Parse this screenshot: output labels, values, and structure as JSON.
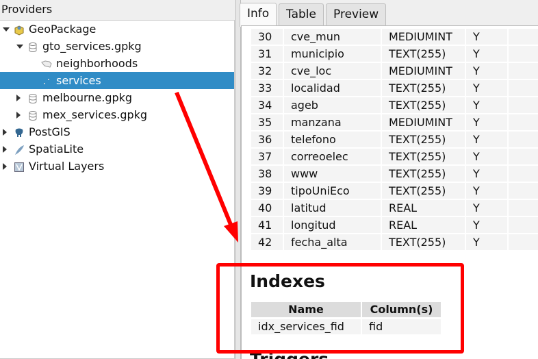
{
  "providers_title": "Providers",
  "tree": [
    {
      "label": "GeoPackage",
      "icon": "geopackage-icon",
      "level": 0,
      "expanded": true
    },
    {
      "label": "gto_services.gpkg",
      "icon": "database-icon",
      "level": 1,
      "expanded": true
    },
    {
      "label": "neighborhoods",
      "icon": "polygon-layer-icon",
      "level": 2
    },
    {
      "label": "services",
      "icon": "point-layer-icon",
      "level": 2,
      "selected": true
    },
    {
      "label": "melbourne.gpkg",
      "icon": "database-icon",
      "level": 1,
      "expanded": false
    },
    {
      "label": "mex_services.gpkg",
      "icon": "database-icon",
      "level": 1,
      "expanded": false
    },
    {
      "label": "PostGIS",
      "icon": "postgis-icon",
      "level": 0,
      "expanded": false
    },
    {
      "label": "SpatiaLite",
      "icon": "spatialite-feather-icon",
      "level": 0,
      "expanded": false
    },
    {
      "label": "Virtual Layers",
      "icon": "virtual-layers-icon",
      "level": 0,
      "expanded": false
    }
  ],
  "tabs": [
    "Info",
    "Table",
    "Preview"
  ],
  "fields": [
    [
      "30",
      "cve_mun",
      "MEDIUMINT",
      "Y"
    ],
    [
      "31",
      "municipio",
      "TEXT(255)",
      "Y"
    ],
    [
      "32",
      "cve_loc",
      "MEDIUMINT",
      "Y"
    ],
    [
      "33",
      "localidad",
      "TEXT(255)",
      "Y"
    ],
    [
      "34",
      "ageb",
      "TEXT(255)",
      "Y"
    ],
    [
      "35",
      "manzana",
      "MEDIUMINT",
      "Y"
    ],
    [
      "36",
      "telefono",
      "TEXT(255)",
      "Y"
    ],
    [
      "37",
      "correoelec",
      "TEXT(255)",
      "Y"
    ],
    [
      "38",
      "www",
      "TEXT(255)",
      "Y"
    ],
    [
      "39",
      "tipoUniEco",
      "TEXT(255)",
      "Y"
    ],
    [
      "40",
      "latitud",
      "REAL",
      "Y"
    ],
    [
      "41",
      "longitud",
      "REAL",
      "Y"
    ],
    [
      "42",
      "fecha_alta",
      "TEXT(255)",
      "Y"
    ]
  ],
  "indexes": {
    "title": "Indexes",
    "headers": [
      "Name",
      "Column(s)"
    ],
    "rows": [
      [
        "idx_services_fid",
        "fid"
      ]
    ]
  },
  "next_section_title": "Triggers",
  "colors": {
    "selection": "#308cc6",
    "annotation": "#ff0000"
  }
}
